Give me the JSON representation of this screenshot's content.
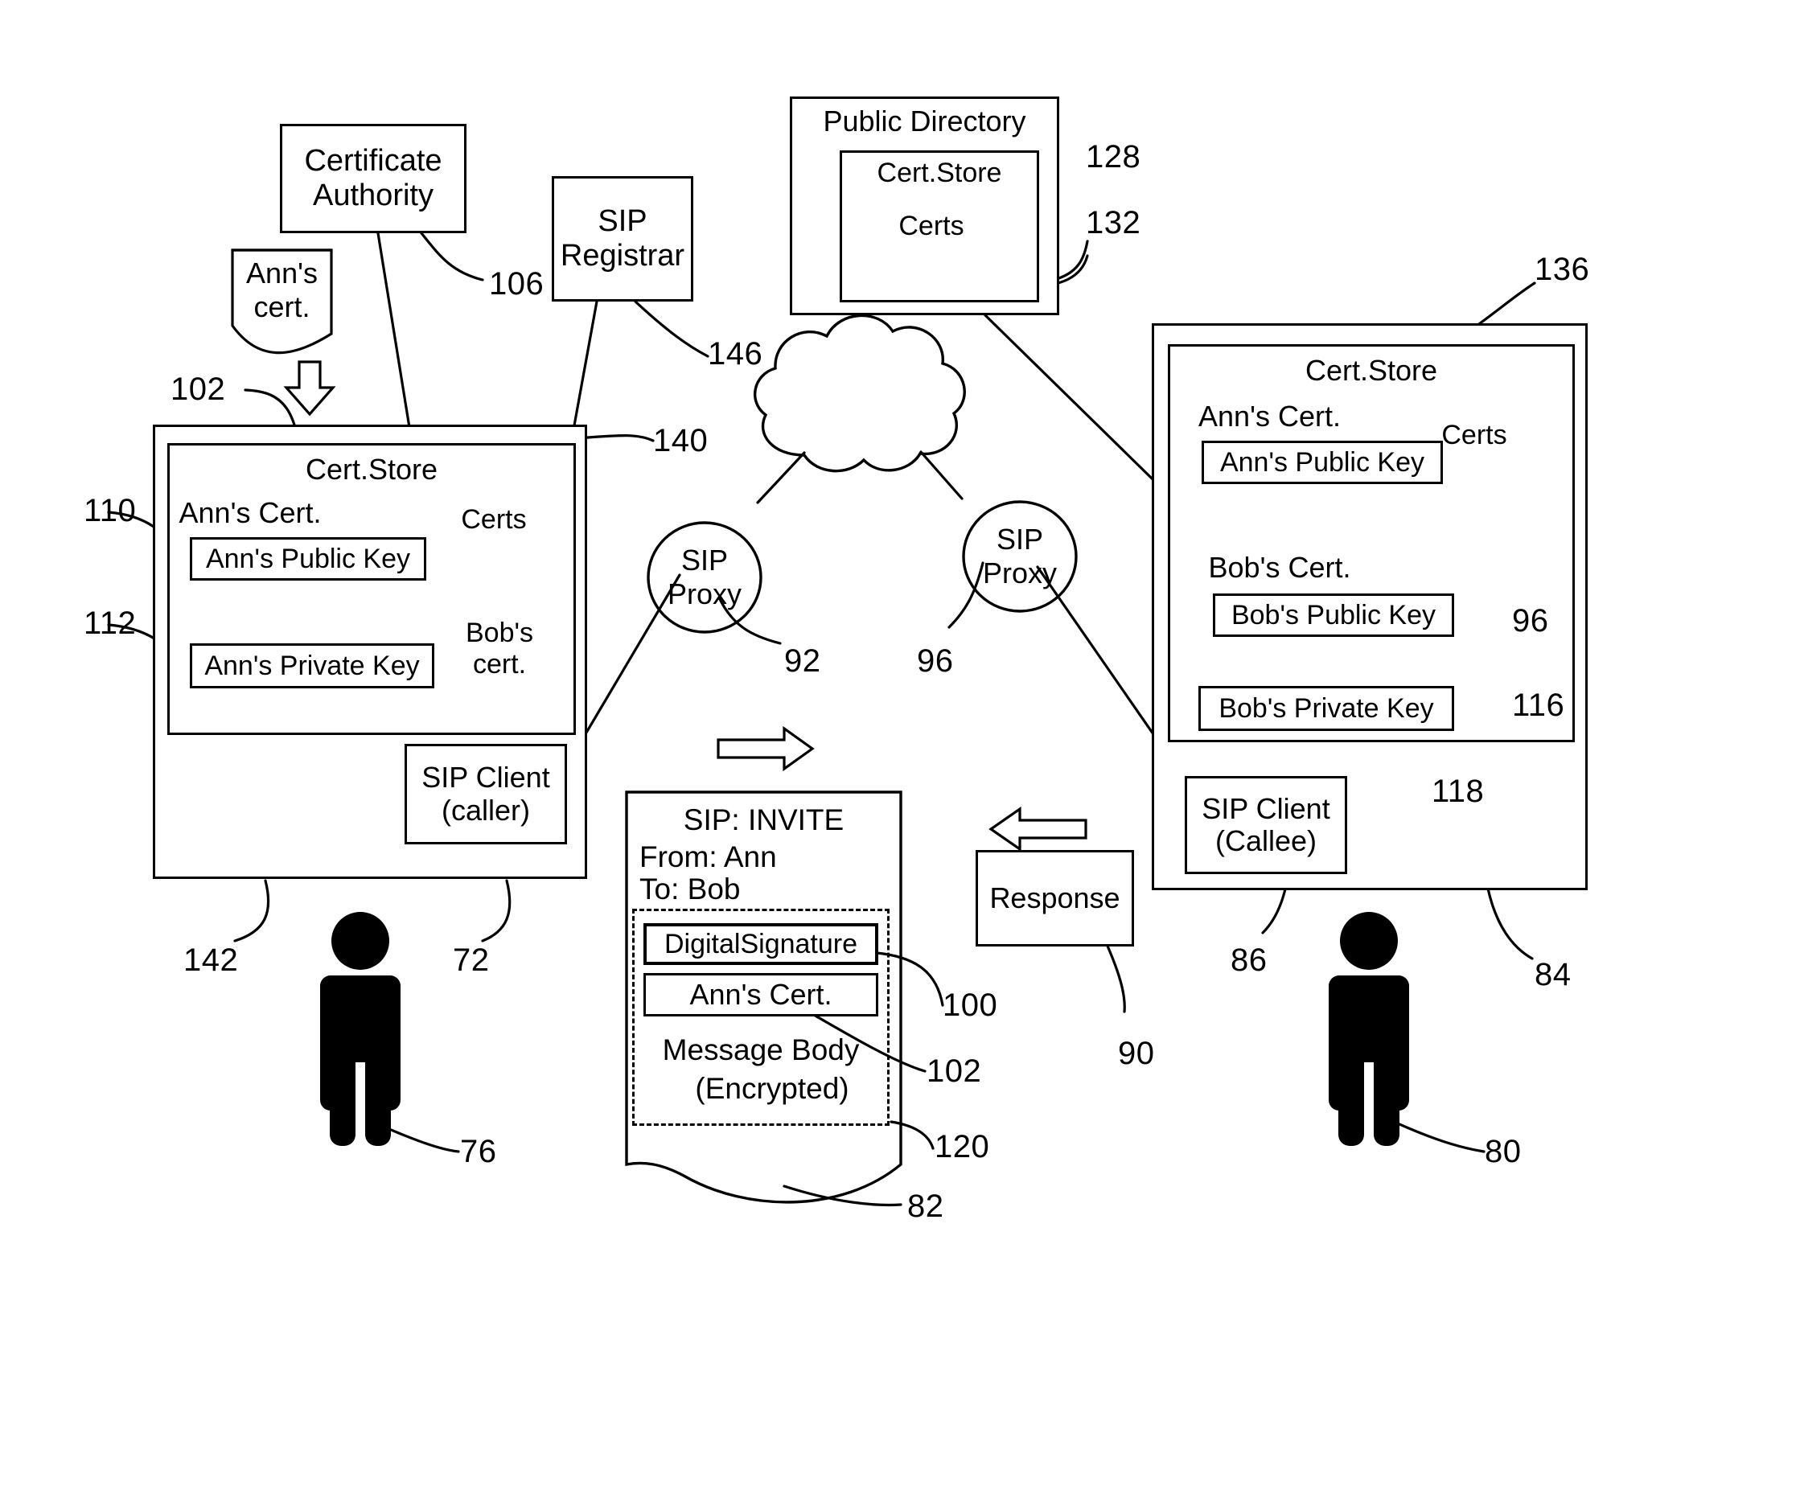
{
  "figure": {
    "domain": "patent-diagram",
    "description": "SIP secure call setup with certificates"
  },
  "nodes": {
    "certificate_authority": "Certificate\nAuthority",
    "anns_cert_doc_top": "Ann's\ncert.",
    "sip_registrar": "SIP\nRegistrar",
    "public_directory": "Public Directory",
    "public_directory_cert_store": "Cert.Store",
    "public_directory_certs": "Certs",
    "left_cert_store": "Cert.Store",
    "left_anns_cert": "Ann's Cert.",
    "left_anns_public_key": "Ann's Public Key",
    "left_anns_private_key": "Ann's Private Key",
    "left_certs": "Certs",
    "left_bobs_cert": "Bob's\ncert.",
    "sip_client_caller": "SIP Client\n(caller)",
    "sip_proxy_left": "SIP\nProxy",
    "sip_proxy_right": "SIP\nProxy",
    "right_cert_store": "Cert.Store",
    "right_anns_cert": "Ann's Cert.",
    "right_anns_public_key": "Ann's Public Key",
    "right_certs": "Certs",
    "right_bobs_cert": "Bob's Cert.",
    "right_bobs_public_key": "Bob's Public Key",
    "right_bobs_private_key": "Bob's Private Key",
    "sip_client_callee": "SIP Client\n(Callee)",
    "response": "Response"
  },
  "message": {
    "title": "SIP: INVITE",
    "from": "From: Ann",
    "to": "To: Bob",
    "digital_signature": "DigitalSignature",
    "anns_cert": "Ann's Cert.",
    "body_line1": "Message Body",
    "body_line2": "(Encrypted)"
  },
  "refs": {
    "r106": "106",
    "r146": "146",
    "r128": "128",
    "r132": "132",
    "r136": "136",
    "r102a": "102",
    "r110": "110",
    "r112": "112",
    "r140": "140",
    "r92": "92",
    "r96a": "96",
    "r96b": "96",
    "r116": "116",
    "r118": "118",
    "r142": "142",
    "r72": "72",
    "r76": "76",
    "r100": "100",
    "r102b": "102",
    "r120": "120",
    "r82": "82",
    "r90": "90",
    "r86": "86",
    "r84": "84",
    "r80": "80"
  },
  "colors": {
    "stroke": "#000000",
    "background": "#ffffff"
  }
}
